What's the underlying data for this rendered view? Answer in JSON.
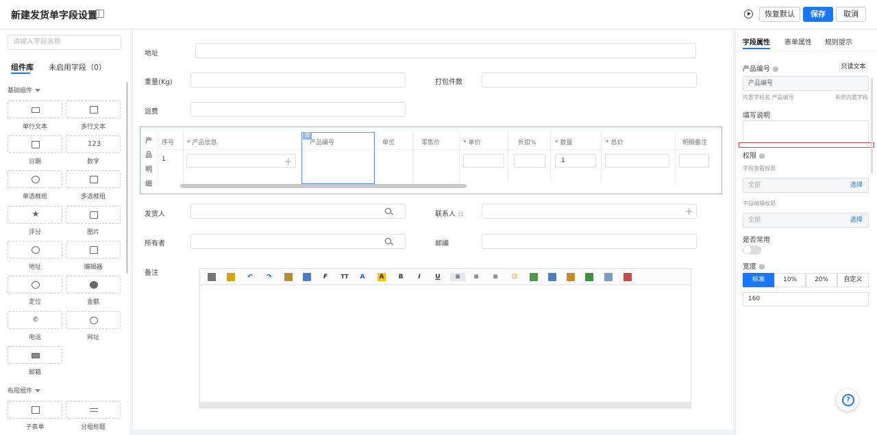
{
  "header": {
    "title": "新建发货单字段设置",
    "restore_label": "恢复默认",
    "save_label": "保存",
    "cancel_label": "取消"
  },
  "left": {
    "search_placeholder": "请输入字段名称",
    "tab_library": "组件库",
    "tab_disabled": "未启用字段（0）",
    "group_basic": "基础组件",
    "group_layout": "布局组件",
    "components": [
      {
        "label": "单行文本",
        "icon": "single-line-text-icon"
      },
      {
        "label": "多行文本",
        "icon": "multi-line-text-icon"
      },
      {
        "label": "日期",
        "icon": "calendar-icon"
      },
      {
        "label": "数字",
        "icon": "number-icon",
        "glyph": "123"
      },
      {
        "label": "单选框组",
        "icon": "radio-icon"
      },
      {
        "label": "多选框组",
        "icon": "checkbox-icon"
      },
      {
        "label": "评分",
        "icon": "star-icon"
      },
      {
        "label": "图片",
        "icon": "image-icon"
      },
      {
        "label": "地址",
        "icon": "location-pin-icon"
      },
      {
        "label": "编辑器",
        "icon": "editor-icon"
      },
      {
        "label": "定位",
        "icon": "map-marker-icon"
      },
      {
        "label": "金额",
        "icon": "money-icon"
      },
      {
        "label": "电话",
        "icon": "phone-icon"
      },
      {
        "label": "网址",
        "icon": "globe-icon"
      },
      {
        "label": "邮箱",
        "icon": "mail-icon"
      }
    ],
    "layout_components": [
      {
        "label": "子表单",
        "icon": "table-icon"
      },
      {
        "label": "分组标题",
        "icon": "group-title-icon"
      }
    ]
  },
  "form": {
    "address_label": "地址",
    "weight_label": "重量(Kg)",
    "package_label": "打包件数",
    "freight_label": "运费",
    "detail_label": [
      "产",
      "品",
      "明",
      "细"
    ],
    "shipper_label": "发货人",
    "contact_label": "联系人",
    "owner_label": "所有者",
    "zip_label": "邮编",
    "remark_label": "备注"
  },
  "grid": {
    "columns": [
      {
        "label": "序号",
        "required": false
      },
      {
        "label": "产品信息",
        "required": true
      },
      {
        "label": "产品编号",
        "required": false
      },
      {
        "label": "单位",
        "required": false
      },
      {
        "label": "零售价",
        "required": false
      },
      {
        "label": "单价",
        "required": true
      },
      {
        "label": "折扣%",
        "required": false
      },
      {
        "label": "数量",
        "required": true
      },
      {
        "label": "总价",
        "required": true
      },
      {
        "label": "明细备注",
        "required": false
      }
    ],
    "row_index": "1",
    "quantity_value": "1",
    "required_mark": "*"
  },
  "right": {
    "tab_field": "字段属性",
    "tab_form": "表单属性",
    "tab_rules": "规则提示",
    "field_name_label": "产品编号",
    "readonly_label": "只读文本",
    "field_name_value": "产品编号",
    "builtin_name": "内置字段名 产品编号",
    "system_builtin": "系统内置字段",
    "fill_desc_label": "填写说明",
    "permission_label": "权限",
    "view_perm_label": "字段查看权限",
    "view_perm_value": "全部",
    "edit_perm_label": "字段编辑权限",
    "edit_perm_value": "全部",
    "select_label": "选择",
    "common_label": "是否常用",
    "width_label": "宽度",
    "width_options": [
      "标准",
      "10%",
      "20%",
      "自定义"
    ],
    "width_value": "160"
  },
  "colors": {
    "accent": "#1677ff",
    "highlight": "#e03b3b"
  }
}
